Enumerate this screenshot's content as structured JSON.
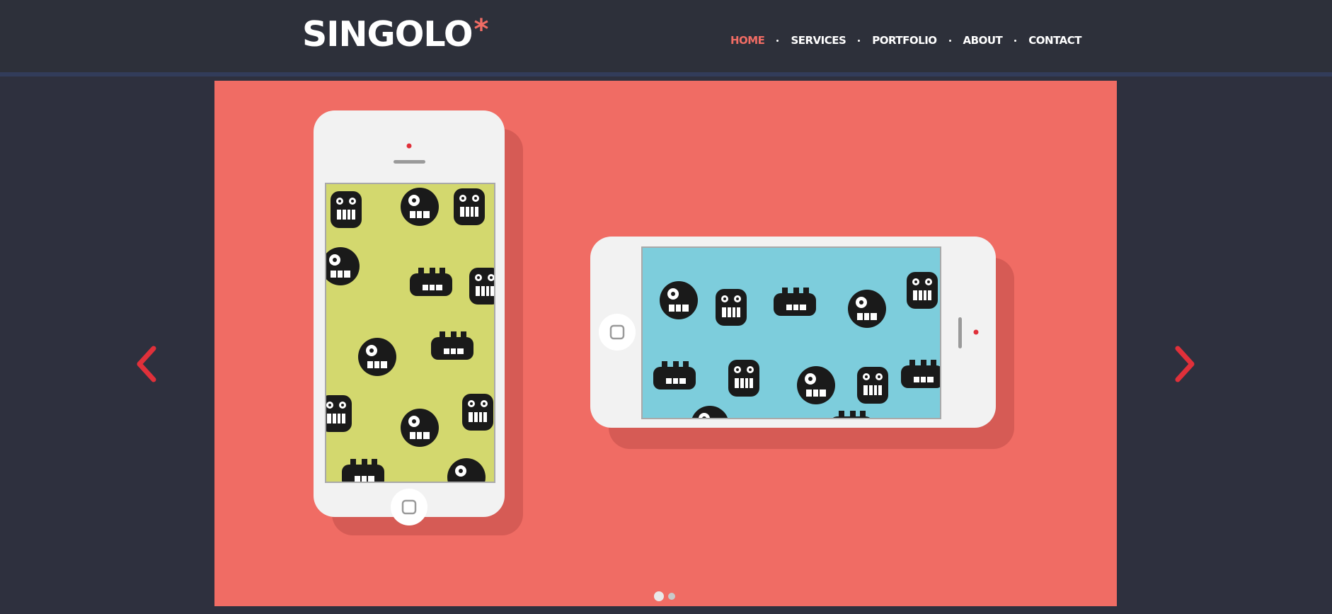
{
  "brand": {
    "name": "SINGOLO",
    "asterisk": "*"
  },
  "nav": {
    "items": [
      {
        "label": "HOME",
        "active": true
      },
      {
        "label": "SERVICES",
        "active": false
      },
      {
        "label": "PORTFOLIO",
        "active": false
      },
      {
        "label": "ABOUT",
        "active": false
      },
      {
        "label": "CONTACT",
        "active": false
      }
    ]
  },
  "slider": {
    "background": "#f06c64",
    "accent": "#e0303a",
    "slides_count": 2,
    "active_slide": 1,
    "prev_icon": "chevron-left-icon",
    "next_icon": "chevron-right-icon",
    "phones": [
      {
        "orientation": "vertical",
        "screen_color": "#d3d86e",
        "pattern": "monster-pattern"
      },
      {
        "orientation": "horizontal",
        "screen_color": "#7dcddc",
        "pattern": "monster-pattern"
      }
    ]
  },
  "colors": {
    "header_bg": "#2d303a",
    "page_bg": "#2e303e",
    "brand_accent": "#f06c64",
    "header_border": "#323c5a"
  }
}
